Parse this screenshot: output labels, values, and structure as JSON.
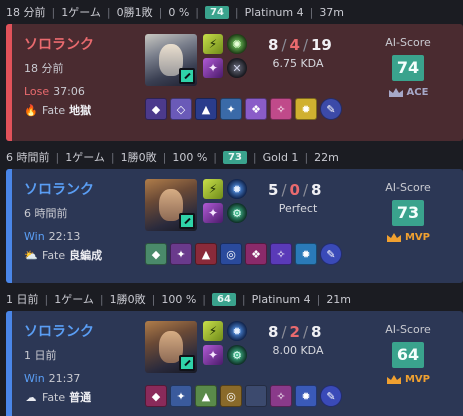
{
  "matches": [
    {
      "header": {
        "time": "18 分前",
        "games": "1ゲーム",
        "record": "0勝1敗",
        "winrate": "0 %",
        "score": "74",
        "rank": "Platinum 4",
        "duration": "37m"
      },
      "card": {
        "outcome": "lose",
        "queue": "ソロランク",
        "ago": "18 分前",
        "result": "Lose",
        "length": "37:06",
        "fate_label": "Fate",
        "fate_value": "地獄",
        "fate_icon": "fire-icon",
        "kills": "8",
        "deaths": "4",
        "assists": "19",
        "ratio": "6.75 KDA",
        "ai_label": "AI-Score",
        "ai_value": "74",
        "tag": "ACE",
        "tag_icon": "crown-icon",
        "items": [
          "#4c3a8c",
          "#6a5ab8",
          "#2a3c8c",
          "#3a6aa8",
          "#8a5cc8",
          "#c04a8a",
          "#d0b030",
          "#3c4aa8"
        ]
      }
    },
    {
      "header": {
        "time": "6 時間前",
        "games": "1ゲーム",
        "record": "1勝0敗",
        "winrate": "100 %",
        "score": "73",
        "rank": "Gold 1",
        "duration": "22m"
      },
      "card": {
        "outcome": "win",
        "queue": "ソロランク",
        "ago": "6 時間前",
        "result": "Win",
        "length": "22:13",
        "fate_label": "Fate",
        "fate_value": "良編成",
        "fate_icon": "sun-cloud-icon",
        "kills": "5",
        "deaths": "0",
        "assists": "8",
        "ratio": "Perfect",
        "ai_label": "AI-Score",
        "ai_value": "73",
        "tag": "MVP",
        "tag_icon": "crown-icon",
        "items": [
          "#4a8a6a",
          "#6a3a8c",
          "#8a2a3a",
          "#2a4a9c",
          "#8a2a6a",
          "#5a3ab8",
          "#2a7ab8",
          "#3a4ab8"
        ]
      }
    },
    {
      "header": {
        "time": "1 日前",
        "games": "1ゲーム",
        "record": "1勝0敗",
        "winrate": "100 %",
        "score": "64",
        "rank": "Platinum 4",
        "duration": "21m"
      },
      "card": {
        "outcome": "win",
        "queue": "ソロランク",
        "ago": "1 日前",
        "result": "Win",
        "length": "21:37",
        "fate_label": "Fate",
        "fate_value": "普通",
        "fate_icon": "cloud-icon",
        "kills": "8",
        "deaths": "2",
        "assists": "8",
        "ratio": "8.00 KDA",
        "ai_label": "AI-Score",
        "ai_value": "64",
        "tag": "MVP",
        "tag_icon": "crown-icon",
        "items": [
          "#8a2a5a",
          "#3a5a9c",
          "#5a8a4a",
          "#8a6a2a",
          "#3c4a6e",
          "#8a3a8a",
          "#3a5ab8",
          "#3a4ab8"
        ]
      }
    }
  ]
}
